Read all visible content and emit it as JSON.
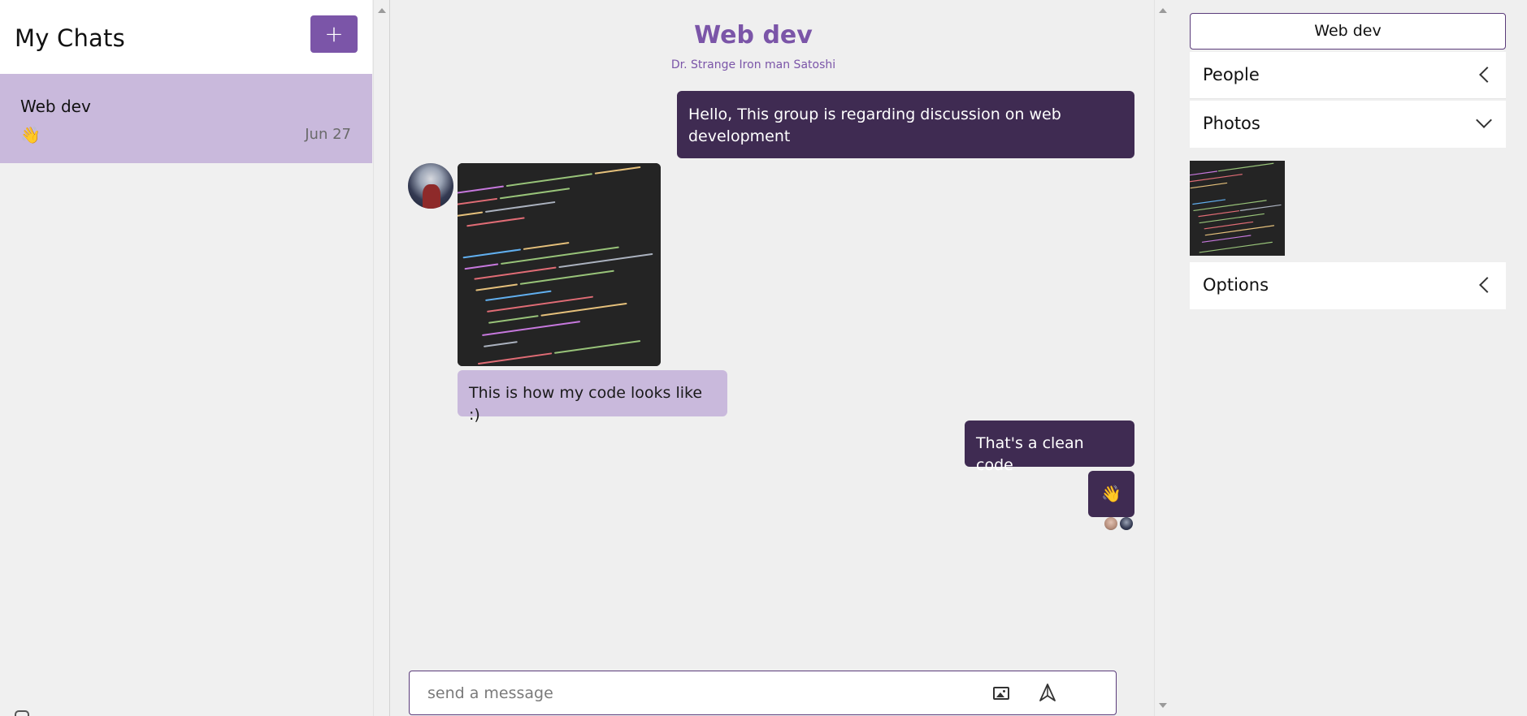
{
  "sidebar": {
    "title": "My Chats",
    "new_chat_label": "+",
    "chats": [
      {
        "name": "Web dev",
        "preview": "👋",
        "date": "Jun 27"
      }
    ]
  },
  "chat": {
    "title": "Web dev",
    "members": "Dr. Strange Iron man Satoshi",
    "messages": [
      {
        "direction": "outgoing",
        "text": "Hello, This group is regarding discussion on web development"
      },
      {
        "direction": "incoming",
        "type": "image",
        "alt": "code screenshot"
      },
      {
        "direction": "incoming",
        "text": "This is how my code looks like :)"
      },
      {
        "direction": "outgoing",
        "text": "That's a clean code"
      },
      {
        "direction": "outgoing",
        "text": "👋"
      }
    ],
    "input": {
      "placeholder": "send a message",
      "value": ""
    }
  },
  "right_panel": {
    "group_name": "Web dev",
    "sections": [
      {
        "label": "People",
        "state": "collapsed"
      },
      {
        "label": "Photos",
        "state": "expanded"
      },
      {
        "label": "Options",
        "state": "collapsed"
      }
    ]
  },
  "colors": {
    "accent": "#7b55a8",
    "outgoing_bubble": "#3f2b52",
    "incoming_bubble": "#c9b9dc",
    "background": "#efefef"
  },
  "icons": {
    "new_chat": "plus-icon",
    "attach_image": "image-icon",
    "send": "send-icon",
    "section_collapsed": "chevron-left-icon",
    "section_expanded": "chevron-down-icon"
  }
}
